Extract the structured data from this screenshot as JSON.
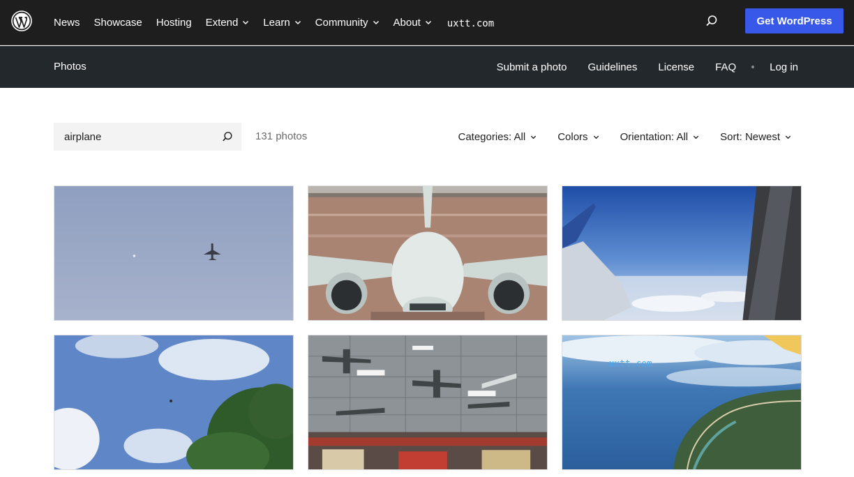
{
  "topnav": {
    "items": [
      {
        "label": "News",
        "has_menu": false
      },
      {
        "label": "Showcase",
        "has_menu": false
      },
      {
        "label": "Hosting",
        "has_menu": false
      },
      {
        "label": "Extend",
        "has_menu": true
      },
      {
        "label": "Learn",
        "has_menu": true
      },
      {
        "label": "Community",
        "has_menu": true
      },
      {
        "label": "About",
        "has_menu": true
      }
    ],
    "domain": "uxtt.com",
    "cta_label": "Get WordPress",
    "cta_color": "#3858e9"
  },
  "subnav": {
    "title": "Photos",
    "links": [
      "Submit a photo",
      "Guidelines",
      "License",
      "FAQ"
    ],
    "login": "Log in"
  },
  "search": {
    "value": "airplane",
    "count": "131 photos"
  },
  "filters": [
    "Categories: All",
    "Colors",
    "Orientation: All",
    "Sort: Newest"
  ],
  "photos": [
    {
      "subject": "plane-in-sky",
      "row": 0,
      "col": 0
    },
    {
      "subject": "jet-front-tarmac",
      "row": 0,
      "col": 1
    },
    {
      "subject": "wing-above-clouds",
      "row": 0,
      "col": 2
    },
    {
      "subject": "plane-over-tree",
      "row": 1,
      "col": 0
    },
    {
      "subject": "model-planes-store",
      "row": 1,
      "col": 1
    },
    {
      "subject": "aerial-coastline",
      "row": 1,
      "col": 2
    }
  ],
  "watermark": "uxtt.com"
}
